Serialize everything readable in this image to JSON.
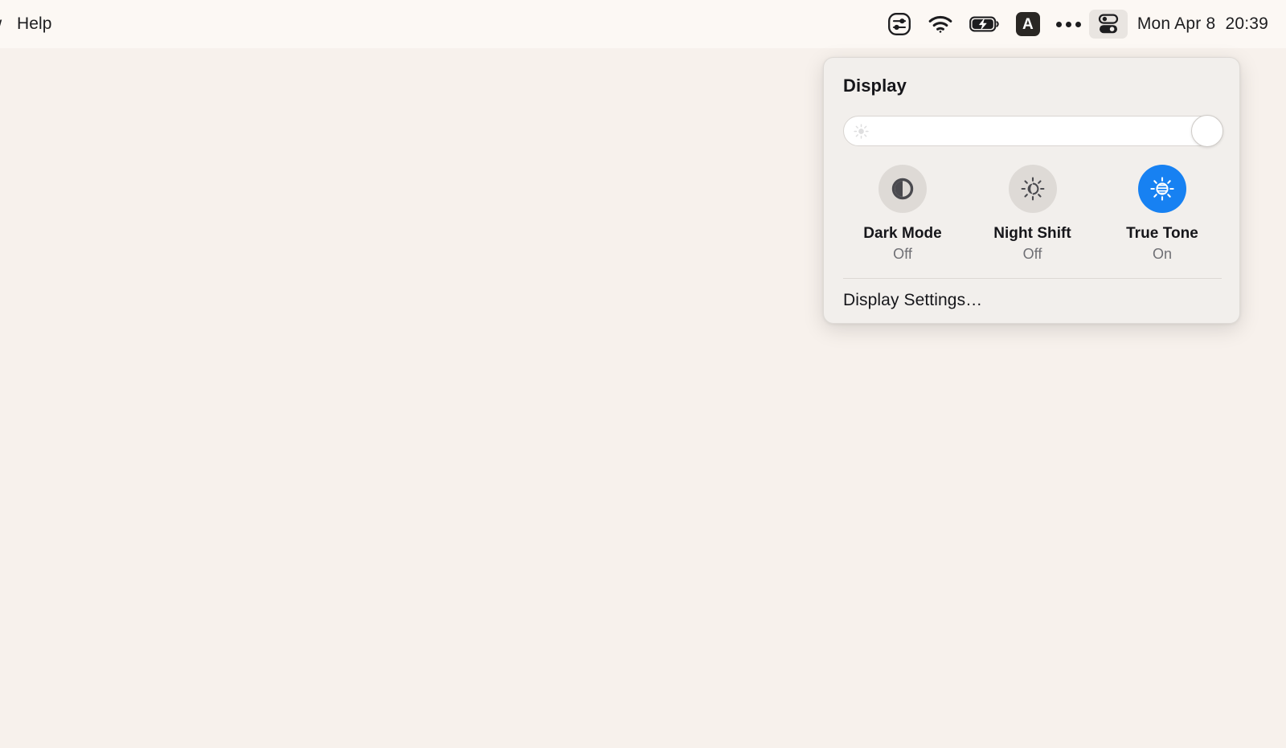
{
  "desktop": {
    "background_color": "#f7f1ec"
  },
  "menubar": {
    "background_color": "#fcf8f4",
    "app_menus": [
      {
        "label": "w",
        "clipped": true
      },
      {
        "label": "Help",
        "clipped": false
      }
    ],
    "status_items": [
      {
        "icon": "sliders-control-icon",
        "name": "display-controls-status-icon"
      },
      {
        "icon": "wifi-icon",
        "name": "wifi-status-icon"
      },
      {
        "icon": "battery-charging-icon",
        "name": "battery-status-icon"
      },
      {
        "icon": "keyboard-input-source-icon",
        "label": "A",
        "name": "input-source-status-icon"
      },
      {
        "icon": "ellipsis-icon",
        "name": "menu-extras-status-icon"
      },
      {
        "icon": "control-center-icon",
        "name": "control-center-status-icon",
        "active": true
      }
    ],
    "clock": "Mon Apr 8  20:39"
  },
  "display_popover": {
    "title": "Display",
    "background_color": "#f2efec",
    "brightness": {
      "icon": "brightness-sun-icon",
      "value": 100,
      "fill_color": "#ffffff"
    },
    "toggles": [
      {
        "label": "Dark Mode",
        "state": "Off",
        "icon": "dark-mode-contrast-icon",
        "active": false,
        "circle_color": "#dedad6"
      },
      {
        "label": "Night Shift",
        "state": "Off",
        "icon": "night-shift-sun-moon-icon",
        "active": false,
        "circle_color": "#dedad6"
      },
      {
        "label": "True Tone",
        "state": "On",
        "icon": "true-tone-sun-icon",
        "active": true,
        "circle_color": "#1781f2"
      }
    ],
    "settings_link": "Display Settings…"
  }
}
